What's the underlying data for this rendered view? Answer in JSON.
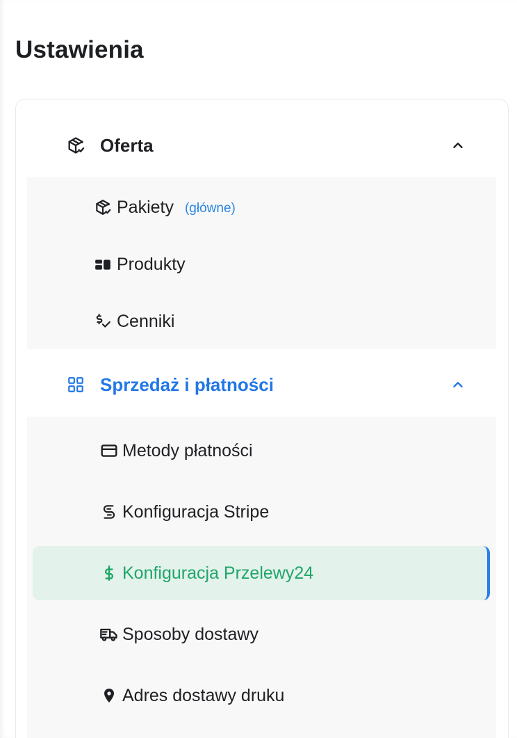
{
  "page": {
    "title": "Ustawienia"
  },
  "colors": {
    "accent_blue": "#2277e6",
    "selected_green": "#1fa66a",
    "selected_bg": "#e3f2ea",
    "badge_blue": "#2a86e0",
    "submenu_bg": "#f8f8f8"
  },
  "sections": [
    {
      "label": "Oferta",
      "icon": "package-check-icon",
      "expanded": true,
      "active": false,
      "items": [
        {
          "label": "Pakiety",
          "badge": "(główne)",
          "icon": "package-icon",
          "selected": false
        },
        {
          "label": "Produkty",
          "icon": "blocks-icon",
          "selected": false
        },
        {
          "label": "Cenniki",
          "icon": "price-check-icon",
          "selected": false
        }
      ]
    },
    {
      "label": "Sprzedaż i płatności",
      "icon": "grid-icon",
      "expanded": true,
      "active": true,
      "items": [
        {
          "label": "Metody płatności",
          "icon": "credit-card-icon",
          "selected": false
        },
        {
          "label": "Konfiguracja Stripe",
          "icon": "stripe-s-icon",
          "selected": false
        },
        {
          "label": "Konfiguracja Przelewy24",
          "icon": "dollar-icon",
          "selected": true
        },
        {
          "label": "Sposoby dostawy",
          "icon": "truck-icon",
          "selected": false
        },
        {
          "label": "Adres dostawy druku",
          "icon": "map-pin-icon",
          "selected": false
        }
      ]
    }
  ]
}
